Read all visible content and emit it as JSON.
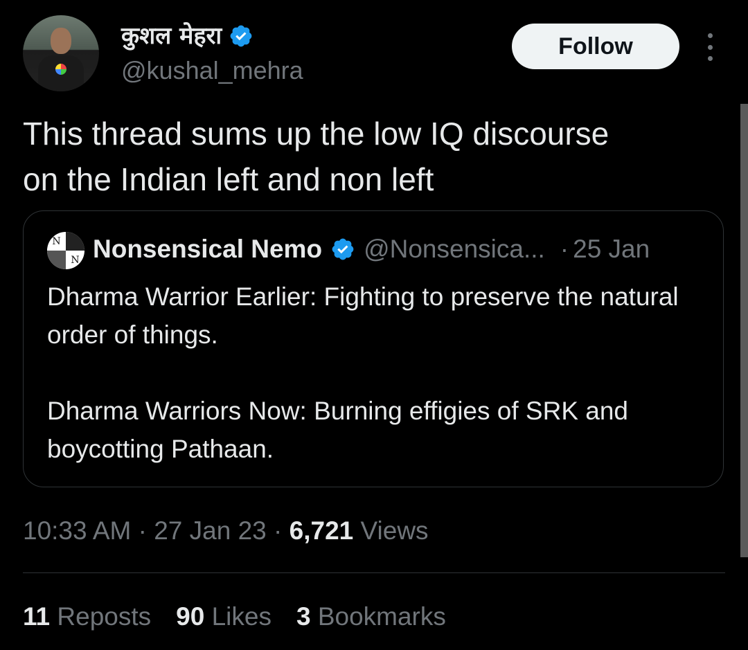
{
  "author": {
    "display_name": "कुशल मेहरा",
    "handle": "@kushal_mehra",
    "verified": true,
    "avatar": "profile-photo"
  },
  "follow_button": {
    "label": "Follow"
  },
  "more_menu": {
    "icon": "more-vertical-icon"
  },
  "tweet": {
    "text": "This thread sums up the low IQ discourse\non the Indian left and non left"
  },
  "quoted_tweet": {
    "display_name": "Nonsensical Nemo",
    "handle": "@Nonsensica...",
    "separator": "·",
    "date": "25 Jan",
    "verified": true,
    "avatar_letters": [
      "N",
      "",
      "",
      "N"
    ],
    "paragraphs": [
      "Dharma Warrior Earlier: Fighting to preserve the natural order of things.",
      "Dharma Warriors Now: Burning effigies of SRK and boycotting Pathaan."
    ]
  },
  "meta": {
    "time": "10:33 AM",
    "sep1": "·",
    "date": "27 Jan 23",
    "sep2": "·",
    "views_count": "6,721",
    "views_label": "Views"
  },
  "stats": {
    "reposts_count": "11",
    "reposts_label": "Reposts",
    "likes_count": "90",
    "likes_label": "Likes",
    "bookmarks_count": "3",
    "bookmarks_label": "Bookmarks"
  },
  "colors": {
    "background": "#000000",
    "text": "#e7e9ea",
    "secondary": "#71767b",
    "verified_blue": "#1d9bf0",
    "border": "#2f3336"
  }
}
